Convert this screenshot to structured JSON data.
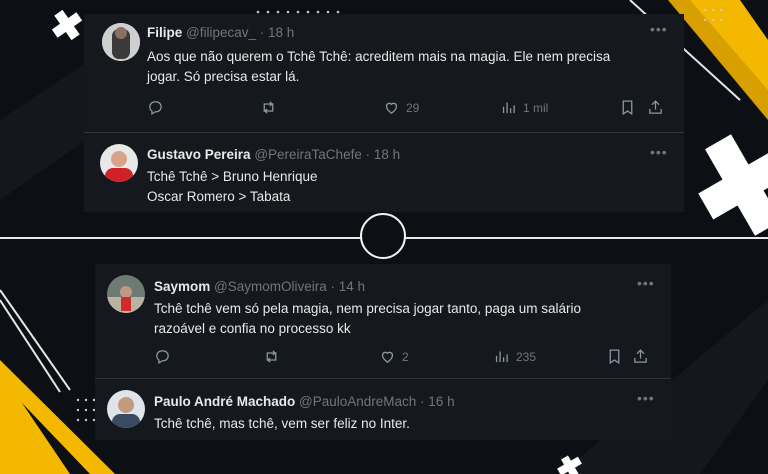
{
  "colors": {
    "accent_yellow": "#f5b800",
    "card_bg": "#15181c",
    "page_bg": "#0c0f13",
    "muted": "#71767b"
  },
  "top_thread": {
    "tweet1": {
      "name": "Filipe",
      "meta": "@filipecav_ · 18 h",
      "lines": [
        "Aos que não querem o Tchê Tchê: acreditem mais na magia. Ele nem precisa",
        "jogar. Só precisa estar lá."
      ],
      "likes": "29",
      "views": "1 mil"
    },
    "tweet2": {
      "name": "Gustavo Pereira",
      "meta": "@PereiraTaChefe · 18 h",
      "lines": [
        "Tchê Tchê > Bruno Henrique",
        "Oscar Romero > Tabata"
      ]
    }
  },
  "bottom_thread": {
    "tweet1": {
      "name": "Saymom",
      "meta": "@SaymomOliveira · 14 h",
      "lines": [
        "Tchê tchê vem só pela magia, nem precisa jogar tanto, paga um salário",
        "razoável e confia no processo kk"
      ],
      "likes": "2",
      "views": "235"
    },
    "tweet2": {
      "name": "Paulo André Machado",
      "meta": "@PauloAndreMach · 16 h",
      "lines": [
        "Tchê tchê, mas tchê, vem ser feliz no Inter."
      ]
    }
  },
  "icons": {
    "more": "more-dots-icon",
    "reply": "reply-icon",
    "retweet": "retweet-icon",
    "like": "heart-icon",
    "views": "views-chart-icon",
    "bookmark": "bookmark-icon",
    "share": "share-icon"
  }
}
